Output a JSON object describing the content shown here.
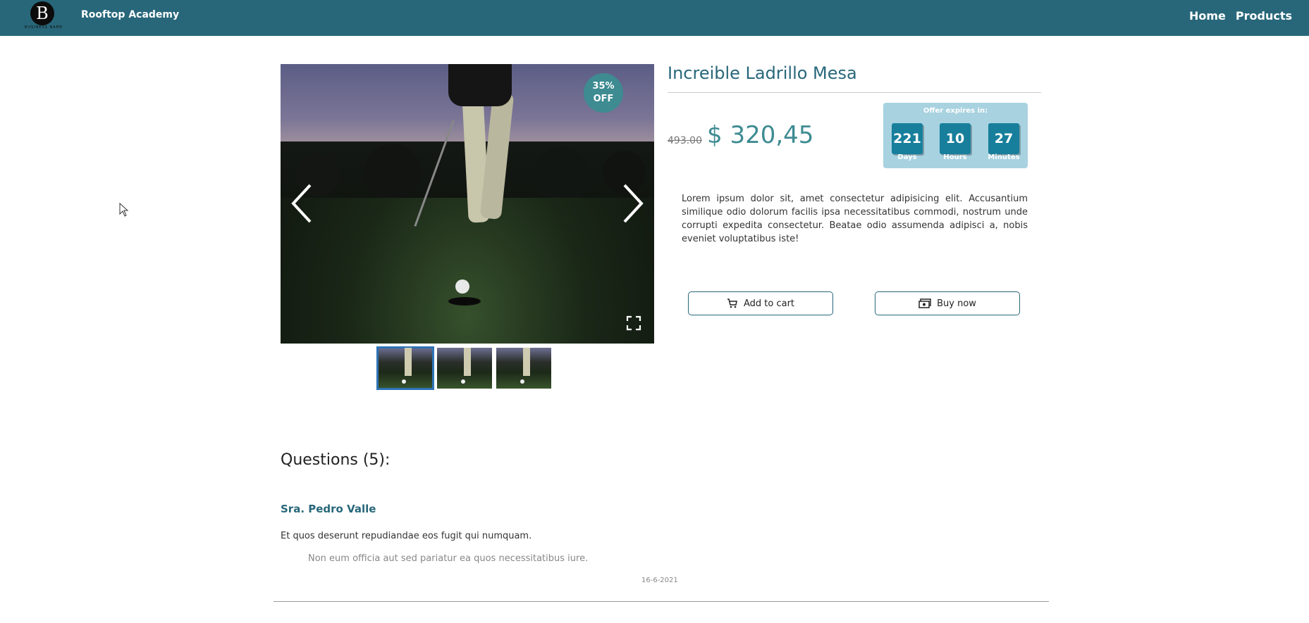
{
  "header": {
    "logo_letter": "B",
    "logo_subtext": "BUSINESS NAME",
    "brand": "Rooftop Academy",
    "nav": [
      {
        "label": "Home"
      },
      {
        "label": "Products"
      }
    ]
  },
  "product": {
    "title": "Increible Ladrillo Mesa",
    "old_price": "493.00",
    "price": "$ 320,45",
    "discount_badge": {
      "line1": "35%",
      "line2": "OFF"
    },
    "offer": {
      "label": "Offer expires in:",
      "days": "221",
      "days_label": "Days",
      "hours": "10",
      "hours_label": "Hours",
      "minutes": "27",
      "minutes_label": "Minutes"
    },
    "description": "Lorem ipsum dolor sit, amet consectetur adipisicing elit. Accusantium similique odio dolorum facilis ipsa necessitatibus commodi, nostrum unde corrupti expedita consectetur. Beatae odio assumenda adipisci a, nobis eveniet voluptatibus iste!",
    "add_to_cart_label": "Add to cart",
    "buy_now_label": "Buy now"
  },
  "questions": {
    "title": "Questions (5):",
    "items": [
      {
        "author": "Sra. Pedro Valle",
        "question": "Et quos deserunt repudiandae eos fugit qui numquam.",
        "answer": "Non eum officia aut sed pariatur ea quos necessitatibus iure.",
        "date": "16-6-2021"
      }
    ]
  },
  "colors": {
    "header_bg": "#28677a",
    "accent": "#3e8b92",
    "offer_bg": "#a8d2e0",
    "counter_bg": "#177f9c",
    "active_thumb": "#2e73b6"
  },
  "icons": [
    "chevron-left-icon",
    "chevron-right-icon",
    "fullscreen-icon",
    "cart-icon",
    "cash-icon",
    "cursor-icon"
  ]
}
